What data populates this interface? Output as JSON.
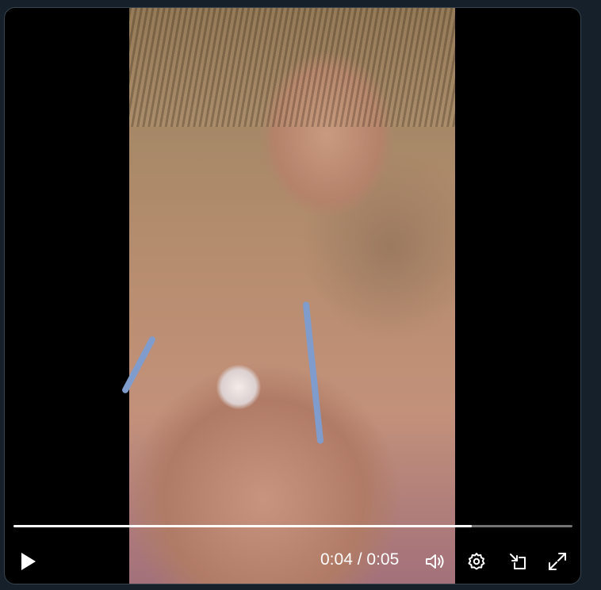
{
  "player": {
    "playback_fraction": 0.82,
    "time": {
      "current": "0:04",
      "separator": " / ",
      "duration": "0:05"
    },
    "controls": {
      "play_icon": "play-icon",
      "volume_icon": "volume-icon",
      "settings_icon": "gear-icon",
      "pip_icon": "picture-in-picture-icon",
      "fullscreen_icon": "expand-icon"
    },
    "colors": {
      "background": "#15202b",
      "player": "#000000",
      "progress_fill": "#ffffff"
    }
  }
}
